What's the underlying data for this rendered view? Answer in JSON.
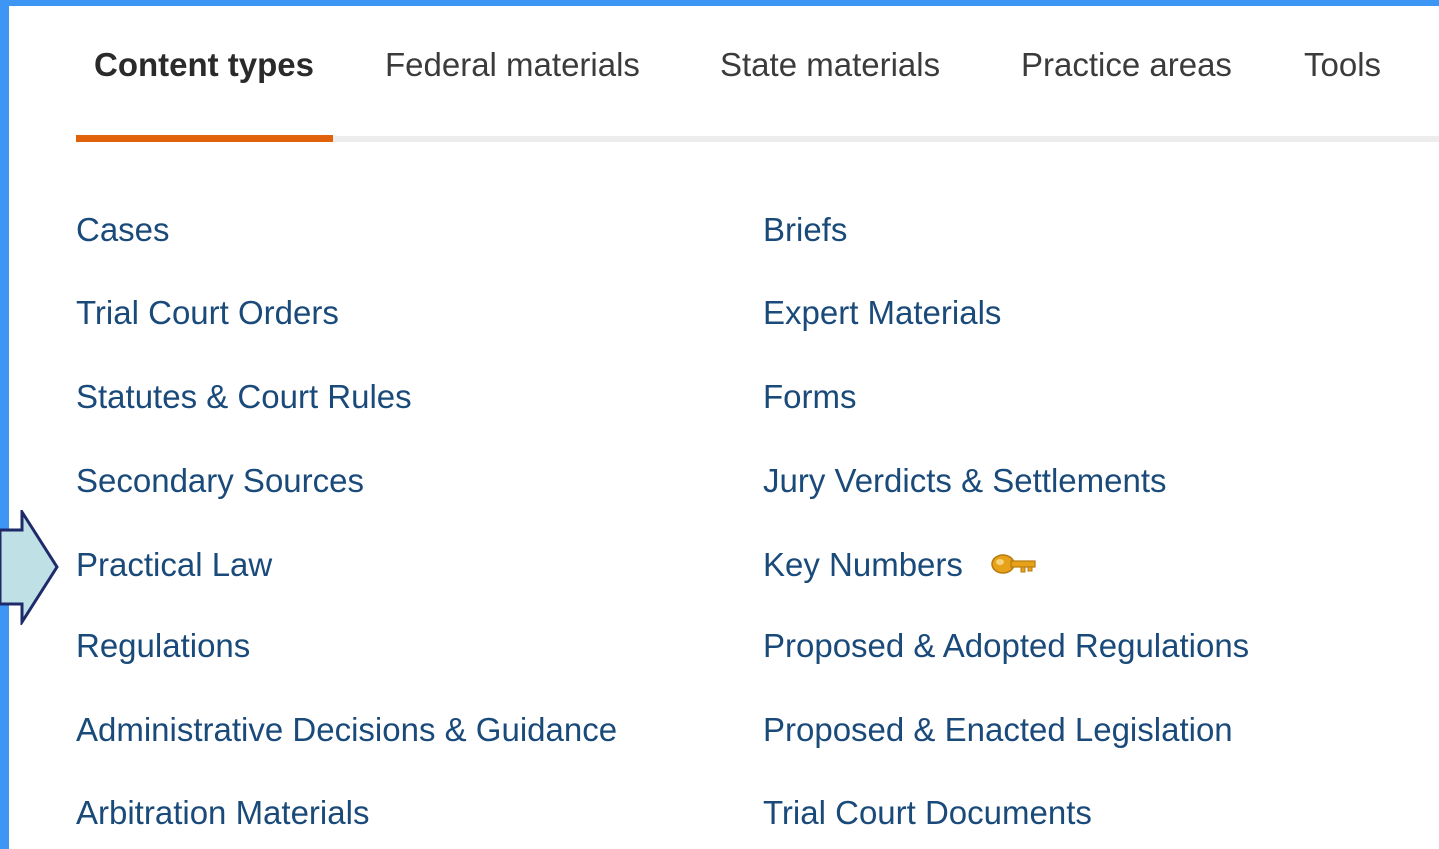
{
  "tabs": [
    {
      "label": "Content types",
      "active": true
    },
    {
      "label": "Federal materials",
      "active": false
    },
    {
      "label": "State materials",
      "active": false
    },
    {
      "label": "Practice areas",
      "active": false
    },
    {
      "label": "Tools",
      "active": false
    }
  ],
  "left_column": [
    "Cases",
    "Trial Court Orders",
    "Statutes & Court Rules",
    "Secondary Sources",
    "Practical Law",
    "Regulations",
    "Administrative Decisions & Guidance",
    "Arbitration Materials"
  ],
  "right_column": [
    "Briefs",
    "Expert Materials",
    "Forms",
    "Jury Verdicts & Settlements",
    "Key Numbers",
    "Proposed & Adopted Regulations",
    "Proposed & Enacted Legislation",
    "Trial Court Documents"
  ],
  "icons": {
    "key_numbers": "key-icon",
    "pointer": "arrow-right-icon"
  },
  "colors": {
    "frame_border": "#3d96f4",
    "active_tab_underline": "#e2610b",
    "link": "#1a4a7a",
    "key_icon": "#e7a21a",
    "pointer_fill": "#bfe0e5",
    "pointer_stroke": "#1f2a6b"
  }
}
